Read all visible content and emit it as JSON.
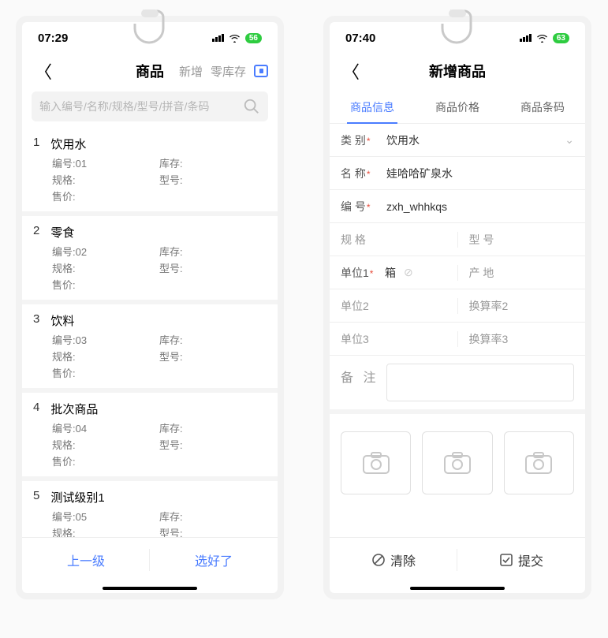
{
  "left": {
    "statusbar": {
      "time": "07:29",
      "battery": "56"
    },
    "header": {
      "title": "商品",
      "action_add": "新增",
      "action_zero": "零库存"
    },
    "search": {
      "placeholder": "输入编号/名称/规格/型号/拼音/条码"
    },
    "labels": {
      "code": "编号:",
      "stock": "库存:",
      "spec": "规格:",
      "model": "型号:",
      "price": "售价:"
    },
    "items": [
      {
        "idx": "1",
        "name": "饮用水",
        "code": "01",
        "stock": "",
        "spec": "",
        "model": "",
        "price": ""
      },
      {
        "idx": "2",
        "name": "零食",
        "code": "02",
        "stock": "",
        "spec": "",
        "model": "",
        "price": ""
      },
      {
        "idx": "3",
        "name": "饮料",
        "code": "03",
        "stock": "",
        "spec": "",
        "model": "",
        "price": ""
      },
      {
        "idx": "4",
        "name": "批次商品",
        "code": "04",
        "stock": "",
        "spec": "",
        "model": "",
        "price": ""
      },
      {
        "idx": "5",
        "name": "测试级别1",
        "code": "05",
        "stock": "",
        "spec": "",
        "model": "",
        "price": ""
      }
    ],
    "footer": {
      "prev": "上一级",
      "done": "选好了"
    }
  },
  "right": {
    "statusbar": {
      "time": "07:40",
      "battery": "63"
    },
    "header": {
      "title": "新增商品"
    },
    "tabs": {
      "info": "商品信息",
      "price": "商品价格",
      "barcode": "商品条码"
    },
    "form": {
      "category_label": "类  别",
      "category_value": "饮用水",
      "name_label": "名  称",
      "name_value": "娃哈哈矿泉水",
      "code_label": "编  号",
      "code_value": "zxh_whhkqs",
      "spec_label": "规  格",
      "spec_value": "",
      "model_label": "型  号",
      "model_value": "",
      "unit1_label": "单位1",
      "unit1_value": "箱",
      "origin_label": "产  地",
      "origin_value": "",
      "unit2_label": "单位2",
      "rate2_label": "换算率2",
      "unit3_label": "单位3",
      "rate3_label": "换算率3",
      "remark_label": "备 注"
    },
    "footer": {
      "clear": "清除",
      "submit": "提交"
    }
  }
}
